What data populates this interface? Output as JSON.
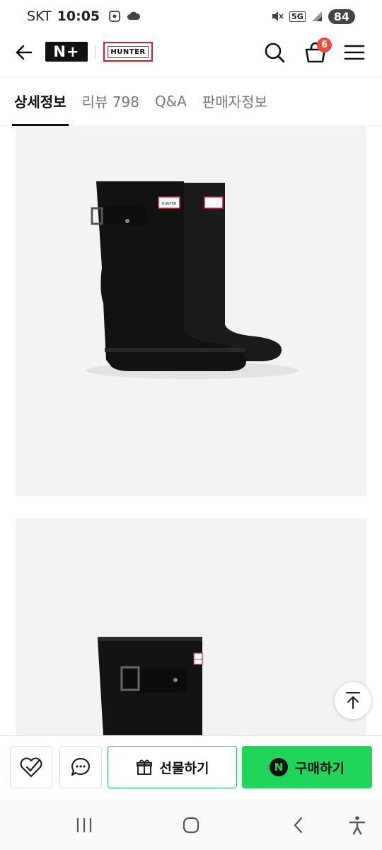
{
  "status_bar": {
    "carrier": "SKT",
    "time": "10:05",
    "network": "5G",
    "battery": "84"
  },
  "header": {
    "brand_mark": "N+",
    "partner_logo": "HUNTER",
    "cart_count": "6",
    "icons": [
      "back-arrow-icon",
      "search-icon",
      "cart-icon",
      "menu-icon"
    ]
  },
  "tabs": [
    {
      "label": "상세정보",
      "active": true
    },
    {
      "label": "리뷰 798",
      "active": false
    },
    {
      "label": "Q&A",
      "active": false
    },
    {
      "label": "판매자정보",
      "active": false
    }
  ],
  "product_images": {
    "image1_label": "HUNTER",
    "image2_label": "HUNTER"
  },
  "actions": {
    "wishlist_icon": "heart-check-icon",
    "chat_icon": "chat-bubble-icon",
    "gift_label": "선물하기",
    "buy_badge": "N",
    "buy_label": "구매하기",
    "buy_color": "#1fd65a",
    "gift_border_color": "#2dbd5a"
  },
  "navbar": {
    "icons": [
      "recent-apps-icon",
      "home-icon",
      "back-icon",
      "accessibility-icon"
    ]
  }
}
